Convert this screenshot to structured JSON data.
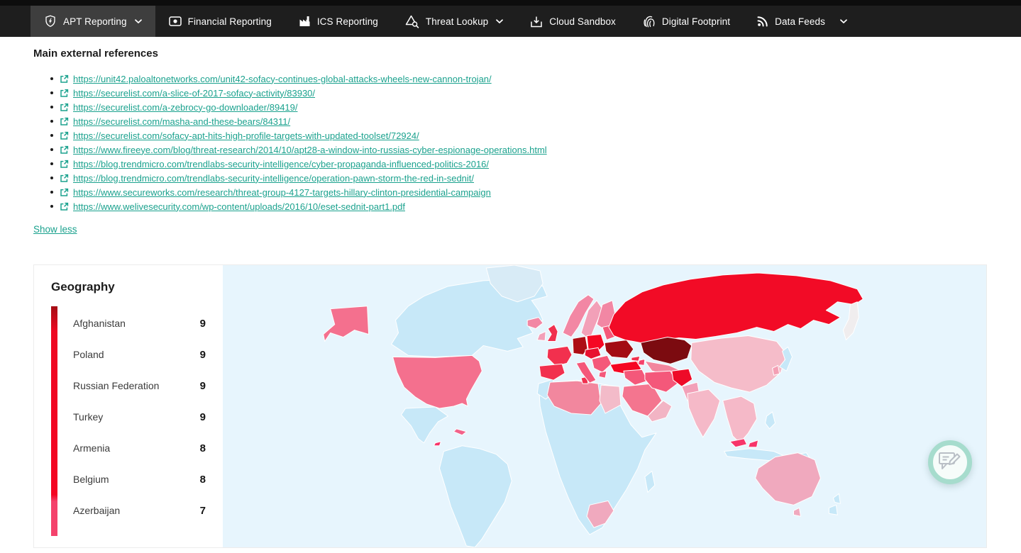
{
  "nav": {
    "items": [
      {
        "label": "APT Reporting",
        "icon": "shield-bolt-icon",
        "has_dropdown": true,
        "active": true
      },
      {
        "label": "Financial Reporting",
        "icon": "banknote-icon",
        "has_dropdown": false,
        "active": false
      },
      {
        "label": "ICS Reporting",
        "icon": "factory-icon",
        "has_dropdown": false,
        "active": false
      },
      {
        "label": "Threat Lookup",
        "icon": "threat-search-icon",
        "has_dropdown": true,
        "active": false
      },
      {
        "label": "Cloud Sandbox",
        "icon": "sandbox-icon",
        "has_dropdown": false,
        "active": false
      },
      {
        "label": "Digital Footprint",
        "icon": "fingerprint-icon",
        "has_dropdown": false,
        "active": false
      },
      {
        "label": "Data Feeds",
        "icon": "rss-icon",
        "has_dropdown": true,
        "active": false
      }
    ]
  },
  "references": {
    "title": "Main external references",
    "links": [
      "https://unit42.paloaltonetworks.com/unit42-sofacy-continues-global-attacks-wheels-new-cannon-trojan/",
      "https://securelist.com/a-slice-of-2017-sofacy-activity/83930/",
      "https://securelist.com/a-zebrocy-go-downloader/89419/",
      "https://securelist.com/masha-and-these-bears/84311/",
      "https://securelist.com/sofacy-apt-hits-high-profile-targets-with-updated-toolset/72924/",
      "https://www.fireeye.com/blog/threat-research/2014/10/apt28-a-window-into-russias-cyber-espionage-operations.html",
      "https://blog.trendmicro.com/trendlabs-security-intelligence/cyber-propaganda-influenced-politics-2016/",
      "https://blog.trendmicro.com/trendlabs-security-intelligence/operation-pawn-storm-the-red-in-sednit/",
      "https://www.secureworks.com/research/threat-group-4127-targets-hillary-clinton-presidential-campaign",
      "https://www.welivesecurity.com/wp-content/uploads/2016/10/eset-sednit-part1.pdf"
    ],
    "toggle_label": "Show less"
  },
  "geography": {
    "title": "Geography",
    "rows": [
      {
        "country": "Afghanistan",
        "count": 9
      },
      {
        "country": "Poland",
        "count": 9
      },
      {
        "country": "Russian Federation",
        "count": 9
      },
      {
        "country": "Turkey",
        "count": 9
      },
      {
        "country": "Armenia",
        "count": 8
      },
      {
        "country": "Belgium",
        "count": 8
      },
      {
        "country": "Azerbaijan",
        "count": 7
      }
    ],
    "legend_stops": [
      {
        "color": "#a50d14",
        "pos": 0
      },
      {
        "color": "#ee0822",
        "pos": 11
      },
      {
        "color": "#f40522",
        "pos": 82
      },
      {
        "color": "#f4426c",
        "pos": 85
      },
      {
        "color": "#f4426c",
        "pos": 100
      }
    ]
  },
  "map": {
    "ocean": "#e7f5fd",
    "regions": {
      "canada": "#c7e8f8",
      "greenland": "#d8ebf6",
      "alaska": "#f4708e",
      "usa": "#f4708e",
      "mexico": "#c7e8f8",
      "cuba": "#f2628a",
      "panama": "#f7356a",
      "southamerica": "#c7e8f8",
      "iceland": "#f287a4",
      "ireland": "#f2a0b8",
      "uk": "#f0304e",
      "norway": "#f287a4",
      "sweden": "#f2a0b8",
      "finland": "#f287a4",
      "baltics": "#f4587a",
      "poland": "#f50723",
      "germany": "#ad0d15",
      "france": "#f2304e",
      "spain": "#f2304e",
      "italy": "#f4587a",
      "centraleu": "#e81130",
      "balkans": "#f4587a",
      "greece": "#f4587a",
      "ukraine": "#a30c13",
      "russia": "#f20b26",
      "kamchatka": "#f0edee",
      "kazakhstan": "#7c0b10",
      "centralasia": "#f2869e",
      "georgia": "#f0304e",
      "armenia": "#e8112c",
      "azerbaijan": "#f4426c",
      "turkey": "#f50723",
      "levant": "#f4587a",
      "saudi": "#f4758f",
      "gulf": "#f2b4c4",
      "iran": "#f4587a",
      "afghanistan": "#ee0b28",
      "pakistan": "#f2a0b8",
      "india": "#f5b9c8",
      "china": "#f5bcc9",
      "korea": "#f4a0b5",
      "japan": "#c7e8f8",
      "seasia": "#f5b9c8",
      "malaysia": "#f7356a",
      "borneomalaysia": "#f7356a",
      "indonesia": "#c7e8f8",
      "newguinea": "#c7e8f8",
      "philippines": "#c7e8f8",
      "morocco": "#c7e8f8",
      "northafrica": "#f2879e",
      "tunisia": "#f0304e",
      "egypt": "#f3bbc9",
      "africa": "#c7e8f8",
      "southafrica": "#f0a9be",
      "madagascar": "#c7e8f8",
      "australia": "#f0a9be",
      "tasmania": "#f0a9be",
      "newzealand": "#c7e8f8"
    }
  },
  "colors": {
    "accent_teal": "#1ba28e",
    "nav_bg": "#1e1e1e",
    "nav_top_strip": "#0d0d0d",
    "nav_active_bg": "#3e3e3e",
    "card_border": "#ececec",
    "feedback_ring": "#a6dccd",
    "feedback_icon": "#b9bfc6"
  }
}
